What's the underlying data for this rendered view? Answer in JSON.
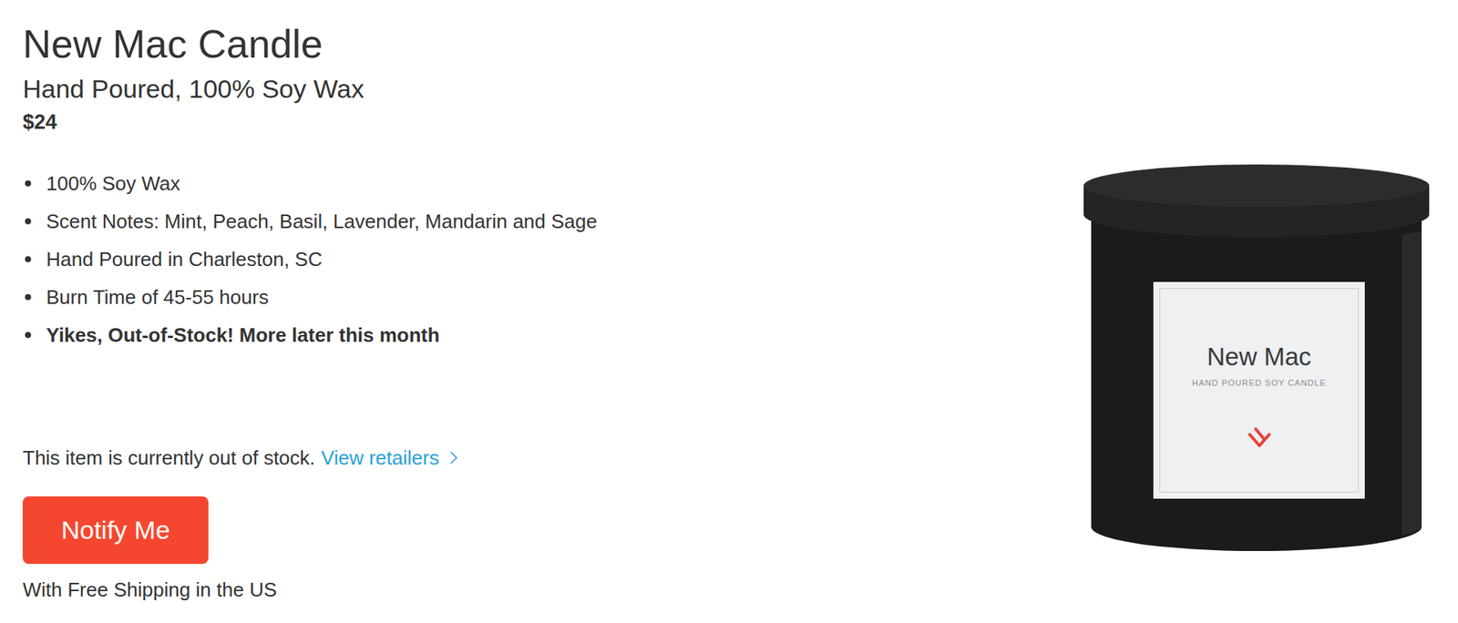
{
  "product": {
    "title": "New Mac Candle",
    "subtitle": "Hand Poured, 100% Soy Wax",
    "price": "$24",
    "features": [
      {
        "text": "100% Soy Wax",
        "bold": false
      },
      {
        "text": "Scent Notes: Mint, Peach, Basil, Lavender, Mandarin and Sage",
        "bold": false
      },
      {
        "text": "Hand Poured in Charleston, SC",
        "bold": false
      },
      {
        "text": "Burn Time of 45-55 hours",
        "bold": false
      },
      {
        "text": "Yikes, Out-of-Stock! More later this month",
        "bold": true
      }
    ],
    "stock_message": "This item is currently out of stock.",
    "retailers_link": "View retailers",
    "notify_button": "Notify Me",
    "shipping_note": "With Free Shipping in the US",
    "image": {
      "label_title": "New Mac",
      "label_subtitle": "HAND POURED SOY CANDLE"
    }
  }
}
